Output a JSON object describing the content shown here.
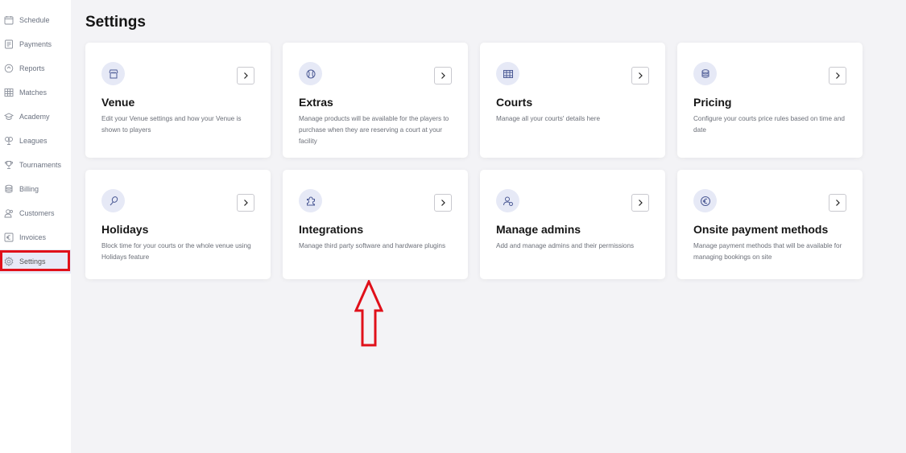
{
  "sidebar": {
    "items": [
      {
        "label": "Schedule",
        "icon": "calendar-icon"
      },
      {
        "label": "Payments",
        "icon": "receipt-icon"
      },
      {
        "label": "Reports",
        "icon": "report-icon"
      },
      {
        "label": "Matches",
        "icon": "table-icon"
      },
      {
        "label": "Academy",
        "icon": "graduation-cap-icon"
      },
      {
        "label": "Leagues",
        "icon": "trophy-group-icon"
      },
      {
        "label": "Tournaments",
        "icon": "trophy-icon"
      },
      {
        "label": "Billing",
        "icon": "coins-icon"
      },
      {
        "label": "Customers",
        "icon": "users-icon"
      },
      {
        "label": "Invoices",
        "icon": "euro-doc-icon"
      },
      {
        "label": "Settings",
        "icon": "gear-icon",
        "active": true
      }
    ]
  },
  "main": {
    "title": "Settings",
    "cards": [
      {
        "title": "Venue",
        "description": "Edit your Venue settings and how your Venue is shown to players",
        "icon": "storefront-icon"
      },
      {
        "title": "Extras",
        "description": "Manage products will be available for the players to purchase when they are reserving a court at your facility",
        "icon": "ball-icon"
      },
      {
        "title": "Courts",
        "description": "Manage all your courts' details here",
        "icon": "court-icon"
      },
      {
        "title": "Pricing",
        "description": "Configure your courts price rules based on time and date",
        "icon": "coins-icon"
      },
      {
        "title": "Holidays",
        "description": "Block time for your courts or the whole venue using Holidays feature",
        "icon": "racket-icon"
      },
      {
        "title": "Integrations",
        "description": "Manage third party software and hardware plugins",
        "icon": "puzzle-icon"
      },
      {
        "title": "Manage admins",
        "description": "Add and manage admins and their permissions",
        "icon": "admin-user-icon"
      },
      {
        "title": "Onsite payment methods",
        "description": "Manage payment methods that will be available for managing bookings on site",
        "icon": "euro-icon"
      }
    ]
  },
  "colors": {
    "accent": "#4c5a95",
    "highlight": "#e0101a",
    "active_bg": "#e8eaf7",
    "page_bg": "#f3f3f6"
  }
}
